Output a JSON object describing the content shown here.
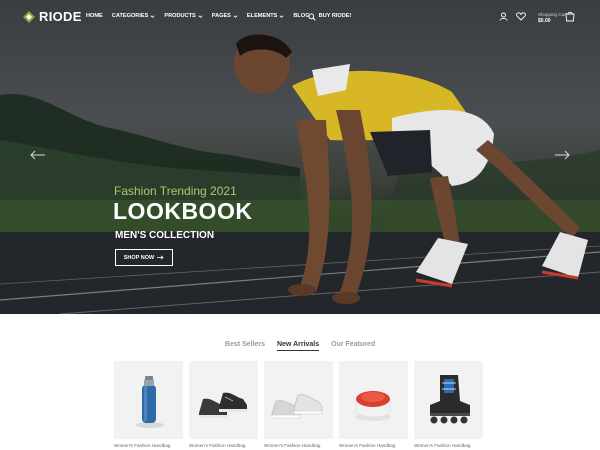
{
  "brand": {
    "name": "RIODE",
    "accent": "#7fad39"
  },
  "nav": {
    "items": [
      {
        "label": "HOME",
        "dropdown": false
      },
      {
        "label": "CATEGORIES",
        "dropdown": true
      },
      {
        "label": "PRODUCTS",
        "dropdown": true
      },
      {
        "label": "PAGES",
        "dropdown": true
      },
      {
        "label": "ELEMENTS",
        "dropdown": true
      },
      {
        "label": "BLOG",
        "dropdown": false
      },
      {
        "label": "BUY RIODE!",
        "dropdown": false
      }
    ]
  },
  "header": {
    "icons": [
      "search-icon",
      "user-icon",
      "heart-icon",
      "cart-icon"
    ],
    "cart_label": "Shopping Cart",
    "cart_total": "$0.00"
  },
  "hero": {
    "subtitle": "Fashion Trending 2021",
    "title": "LOOKBOOK",
    "collection": "MEN'S COLLECTION",
    "button_label": "SHOP NOW",
    "subtitle_color": "#a9c96a"
  },
  "tabs": [
    {
      "label": "Best Sellers",
      "active": false
    },
    {
      "label": "New Arrivals",
      "active": true
    },
    {
      "label": "Our Featured",
      "active": false
    }
  ],
  "products": [
    {
      "name": "Women's Fashion Handbag",
      "image": "blue-bottle"
    },
    {
      "name": "Women's Fashion Handbag",
      "image": "black-sneakers"
    },
    {
      "name": "Women's Fashion Handbag",
      "image": "white-sneakers"
    },
    {
      "name": "Women's Fashion Handbag",
      "image": "red-speaker"
    },
    {
      "name": "Women's Fashion Handbag",
      "image": "inline-skate"
    }
  ]
}
